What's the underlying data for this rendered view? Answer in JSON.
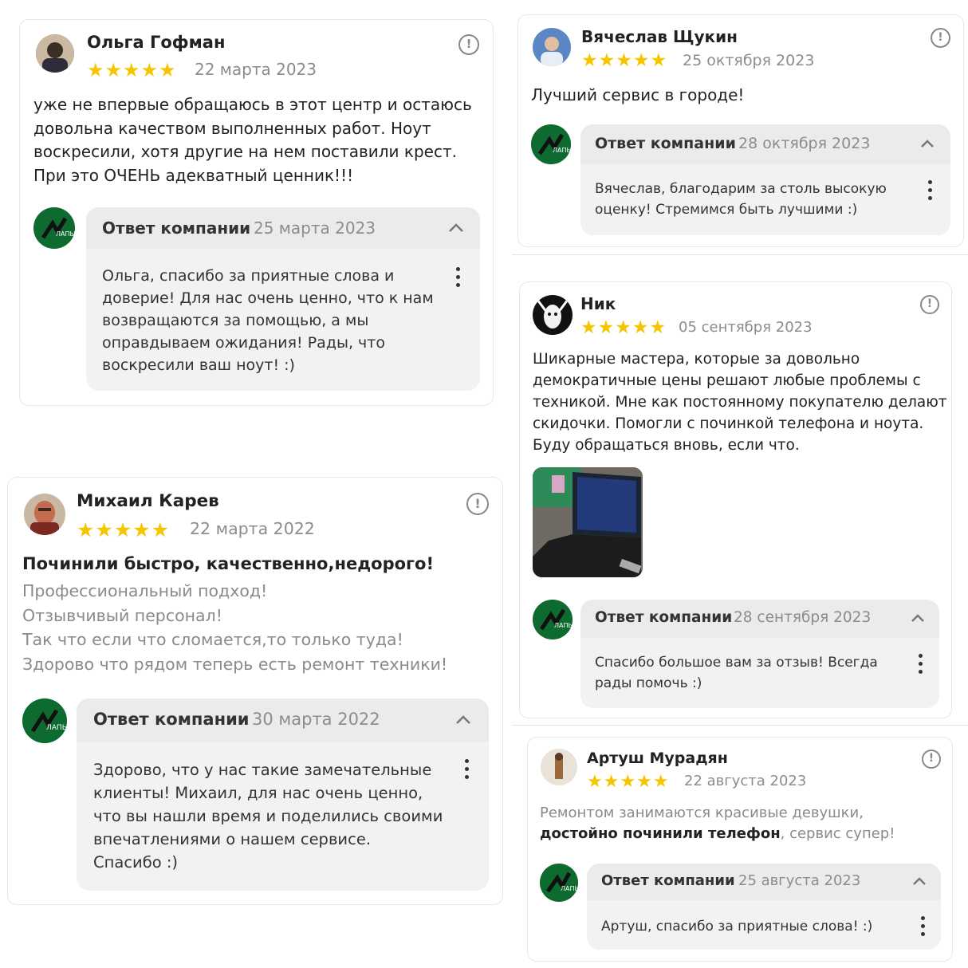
{
  "colors": {
    "star": "#f7c500",
    "reply_bg": "#f2f2f2",
    "logo_green": "#0e6b2f"
  },
  "common": {
    "reply_label": "Ответ компании",
    "stars": "★★★★★",
    "alert_glyph": "!"
  },
  "reviews": [
    {
      "author": "Ольга Гофман",
      "rating": 5,
      "date": "22 марта 2023",
      "text": [
        "уже не впервые обращаюсь в этот центр и остаюсь",
        "довольна качеством выполненных работ. Ноут",
        "воскресили, хотя другие на нем поставили крест.",
        "При это ОЧЕНЬ адекватный ценник!!!"
      ],
      "reply": {
        "date": "25 марта 2023",
        "text": [
          "Ольга, спасибо за приятные слова и",
          "доверие! Для нас очень ценно, что к нам",
          "возвращаются за помощью, а мы",
          "оправдываем ожидания! Рады, что",
          "воскресили ваш ноут! :)"
        ]
      }
    },
    {
      "author": "Вячеслав Щукин",
      "rating": 5,
      "date": "25 октября 2023",
      "text": [
        "Лучший сервис в городе!"
      ],
      "reply": {
        "date": "28 октября 2023",
        "text": [
          "Вячеслав, благодарим за столь высокую",
          "оценку! Стремимся быть лучшими :)"
        ]
      }
    },
    {
      "author": "Ник",
      "rating": 5,
      "date": "05 сентября 2023",
      "text": [
        "Шикарные мастера, которые за довольно",
        "демократичные цены решают любые проблемы с",
        "техникой. Мне как постоянному покупателю делают",
        "скидочки. Помогли с починкой телефона и ноута.",
        "Буду обращаться вновь, если что."
      ],
      "reply": {
        "date": "28 сентября 2023",
        "text": [
          "Спасибо большое вам за отзыв! Всегда",
          "рады помочь :)"
        ]
      }
    },
    {
      "author": "Михаил Карев",
      "rating": 5,
      "date": "22 марта 2022",
      "headline": "Починили быстро, качественно,недорого!",
      "text": [
        "Профессиональный подход!",
        "Отзывчивый персонал!",
        "Так что если что сломается,то только туда!",
        "Здорово что рядом теперь есть ремонт техники!"
      ],
      "reply": {
        "date": "30 марта 2022",
        "text": [
          "Здорово, что у нас такие замечательные",
          "клиенты! Михаил, для нас очень ценно,",
          "что вы нашли время и поделились своими",
          "впечатлениями о нашем сервисе.",
          "Спасибо :)"
        ]
      }
    },
    {
      "author": "Артуш Мурадян",
      "rating": 5,
      "date": "22 августа 2023",
      "text_part1": "Ремонтом занимаются красивые девушки,",
      "text_bold": "достойно починили телефон",
      "text_part2": ", сервис супер!",
      "reply": {
        "date": "25 августа 2023",
        "text": [
          "Артуш, спасибо за приятные слова! :)"
        ]
      }
    }
  ]
}
